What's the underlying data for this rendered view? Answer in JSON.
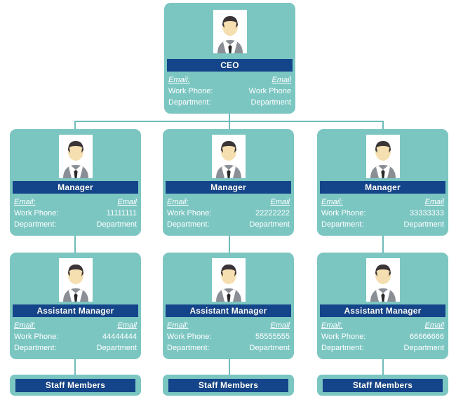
{
  "chart_type": "org-chart",
  "theme": {
    "card_background": "#7cc6c2",
    "title_bar_background": "#14458a",
    "title_text_color": "#ffffff",
    "field_text_color": "#ffffff",
    "connector_color": "#6fbdb9",
    "page_background": "#ffffff",
    "avatar_background": "#ffffff"
  },
  "field_labels": {
    "email": "Email:",
    "work_phone": "Work Phone:",
    "department": "Department:"
  },
  "nodes": {
    "ceo": {
      "title": "CEO",
      "avatar": "person-avatar-icon",
      "fields": {
        "email_label": "Email:",
        "email_value": "Email",
        "phone_label": "Work Phone:",
        "phone_value": "Work Phone",
        "department_label": "Department:",
        "department_value": "Department"
      }
    },
    "managers": [
      {
        "title": "Manager",
        "avatar": "person-avatar-icon",
        "fields": {
          "email_label": "Email:",
          "email_value": "Email",
          "phone_label": "Work Phone:",
          "phone_value": "11111111",
          "department_label": "Department:",
          "department_value": "Department"
        }
      },
      {
        "title": "Manager",
        "avatar": "person-avatar-icon",
        "fields": {
          "email_label": "Email:",
          "email_value": "Email",
          "phone_label": "Work Phone:",
          "phone_value": "22222222",
          "department_label": "Department:",
          "department_value": "Department"
        }
      },
      {
        "title": "Manager",
        "avatar": "person-avatar-icon",
        "fields": {
          "email_label": "Email:",
          "email_value": "Email",
          "phone_label": "Work Phone:",
          "phone_value": "33333333",
          "department_label": "Department:",
          "department_value": "Department"
        }
      }
    ],
    "assistant_managers": [
      {
        "title": "Assistant Manager",
        "avatar": "person-avatar-icon",
        "fields": {
          "email_label": "Email:",
          "email_value": "Email",
          "phone_label": "Work Phone:",
          "phone_value": "44444444",
          "department_label": "Department:",
          "department_value": "Department"
        }
      },
      {
        "title": "Assistant Manager",
        "avatar": "person-avatar-icon",
        "fields": {
          "email_label": "Email:",
          "email_value": "Email",
          "phone_label": "Work Phone:",
          "phone_value": "55555555",
          "department_label": "Department:",
          "department_value": "Department"
        }
      },
      {
        "title": "Assistant Manager",
        "avatar": "person-avatar-icon",
        "fields": {
          "email_label": "Email:",
          "email_value": "Email",
          "phone_label": "Work Phone:",
          "phone_value": "66666666",
          "department_label": "Department:",
          "department_value": "Department"
        }
      }
    ],
    "staff": [
      {
        "title": "Staff Members"
      },
      {
        "title": "Staff Members"
      },
      {
        "title": "Staff Members"
      }
    ]
  }
}
